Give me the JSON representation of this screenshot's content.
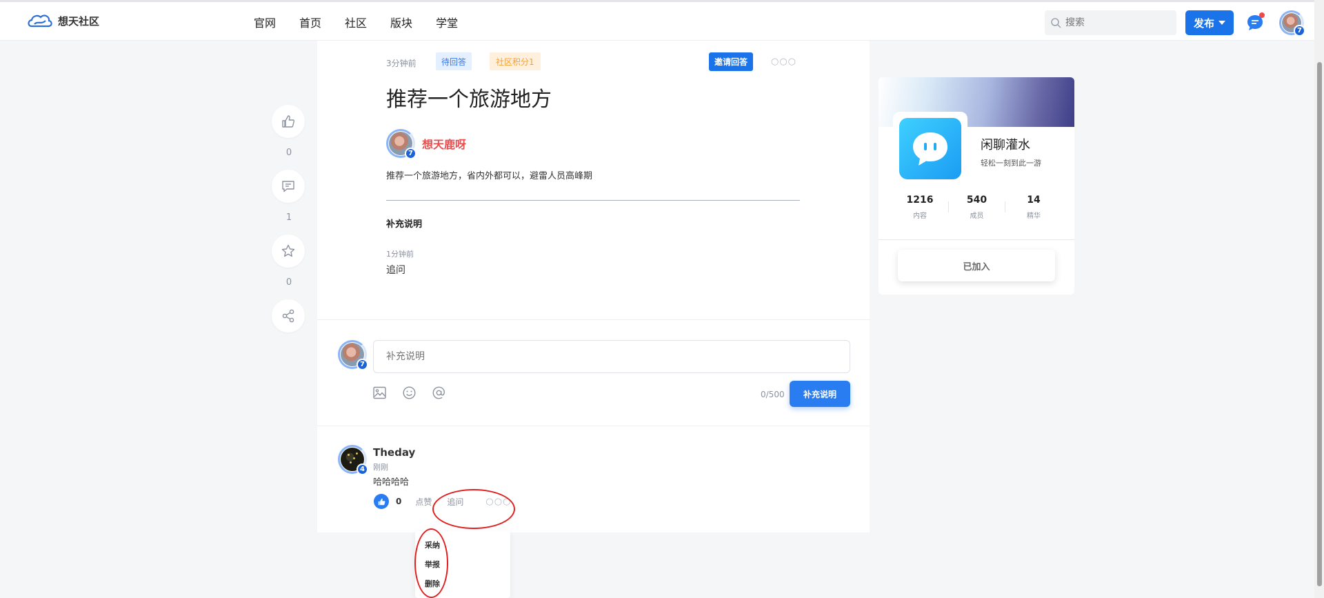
{
  "header": {
    "logo_text": "想天社区",
    "nav": [
      "官网",
      "首页",
      "社区",
      "版块",
      "学堂"
    ],
    "search_placeholder": "搜索",
    "publish_label": "发布",
    "user_level": "7"
  },
  "rail": {
    "like_count": "0",
    "comment_count": "1",
    "favorite_count": "0"
  },
  "question": {
    "time": "3分钟前",
    "status_tag": "待回答",
    "points_tag": "社区积分1",
    "invite_label": "邀请回答",
    "more": "○○○",
    "title": "推荐一个旅游地方",
    "author_name": "想天鹿呀",
    "author_level": "7",
    "body": "推荐一个旅游地方，省内外都可以，避雷人员高峰期",
    "supplement_title": "补充说明",
    "supplement_time": "1分钟前",
    "supplement_text": "追问"
  },
  "reply_box": {
    "user_level": "7",
    "placeholder": "补充说明",
    "counter": "0/500",
    "submit_label": "补充说明"
  },
  "comment": {
    "user_name": "Theday",
    "user_level": "4",
    "time": "刚刚",
    "text": "哈哈哈哈",
    "like_count": "0",
    "like_label": "点赞",
    "followup_label": "追问",
    "more": "○○○"
  },
  "dropdown": [
    "采纳",
    "举报",
    "删除"
  ],
  "community": {
    "name": "闲聊灌水",
    "description": "轻松一刻到此一游",
    "stats": [
      {
        "value": "1216",
        "label": "内容"
      },
      {
        "value": "540",
        "label": "成员"
      },
      {
        "value": "14",
        "label": "精华"
      }
    ],
    "joined_label": "已加入"
  },
  "colors": {
    "primary": "#1a73e8",
    "author": "#e84e4e",
    "annotation": "#e02020"
  }
}
